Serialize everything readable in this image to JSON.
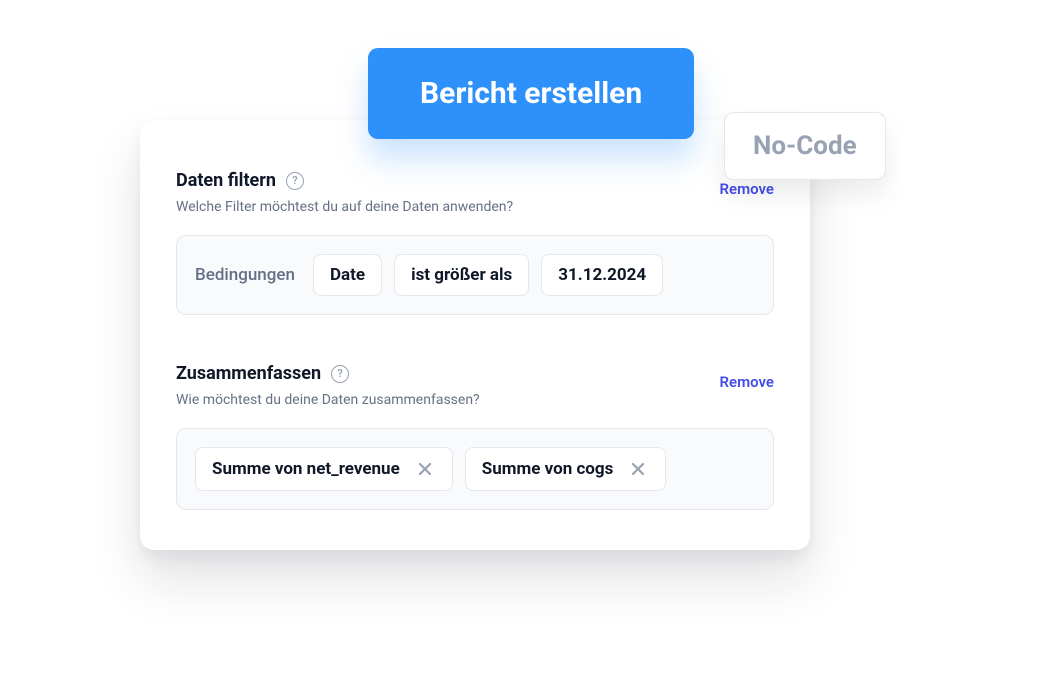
{
  "banner": {
    "primary": "Bericht erstellen",
    "secondary": "No-Code"
  },
  "filter": {
    "title": "Daten filtern",
    "subtitle": "Welche Filter möchtest du auf deine Daten anwenden?",
    "remove": "Remove",
    "conditions_label": "Bedingungen",
    "chips": {
      "field": "Date",
      "operator": "ist größer als",
      "value": "31.12.2024"
    }
  },
  "summarize": {
    "title": "Zusammenfassen",
    "subtitle": "Wie möchtest du deine Daten zusammenfassen?",
    "remove": "Remove",
    "chips": {
      "agg1": "Summe von net_revenue",
      "agg2": "Summe von cogs"
    }
  }
}
